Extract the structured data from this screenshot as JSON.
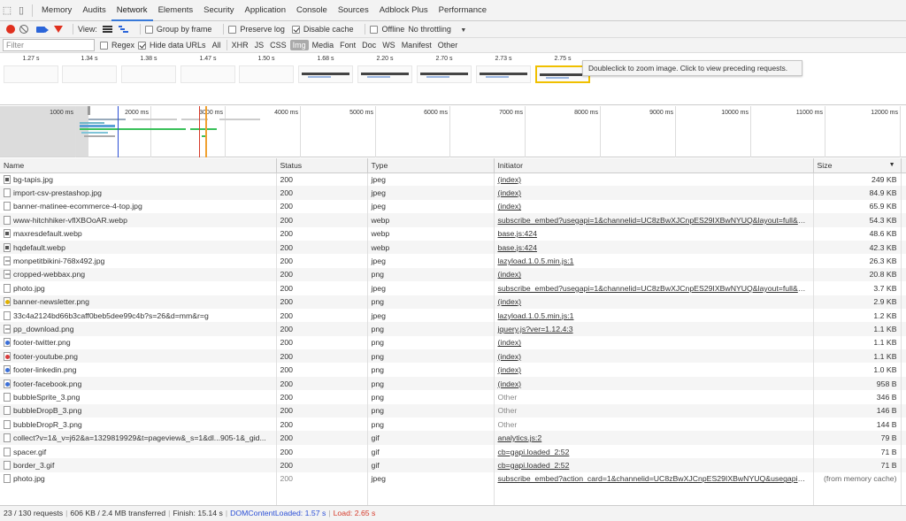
{
  "tabs": [
    "Memory",
    "Audits",
    "Network",
    "Elements",
    "Security",
    "Application",
    "Console",
    "Sources",
    "Adblock Plus",
    "Performance"
  ],
  "active_tab": "Network",
  "toolbar": {
    "view_label": "View:",
    "group_by_frame": "Group by frame",
    "preserve_log": "Preserve log",
    "disable_cache": "Disable cache",
    "offline": "Offline",
    "throttling": "No throttling"
  },
  "filter": {
    "placeholder": "Filter",
    "regex": "Regex",
    "hide_data_urls": "Hide data URLs",
    "types": [
      "All",
      "XHR",
      "JS",
      "CSS",
      "Img",
      "Media",
      "Font",
      "Doc",
      "WS",
      "Manifest",
      "Other"
    ],
    "active_type": "Img"
  },
  "screenshots": [
    "1.27 s",
    "1.34 s",
    "1.38 s",
    "1.47 s",
    "1.50 s",
    "1.68 s",
    "2.20 s",
    "2.70 s",
    "2.73 s",
    "2.75 s"
  ],
  "tooltip": "Doubleclick to zoom image. Click to view preceding requests.",
  "overview": {
    "labels": [
      "1000 ms",
      "2000 ms",
      "3000 ms",
      "4000 ms",
      "5000 ms",
      "6000 ms",
      "7000 ms",
      "8000 ms",
      "9000 ms",
      "10000 ms",
      "11000 ms",
      "12000 ms"
    ],
    "dom_color": "#2b4fd6",
    "load_color": "#d63b2b"
  },
  "columns": {
    "name": "Name",
    "status": "Status",
    "type": "Type",
    "initiator": "Initiator",
    "size": "Size"
  },
  "rows": [
    {
      "name": "bg-tapis.jpg",
      "status": "200",
      "type": "jpeg",
      "initiator": "(index)",
      "size": "249 KB",
      "icon": "img-dark"
    },
    {
      "name": "import-csv-prestashop.jpg",
      "status": "200",
      "type": "jpeg",
      "initiator": "(index)",
      "size": "84.9 KB",
      "icon": "plain"
    },
    {
      "name": "banner-matinee-ecommerce-4-top.jpg",
      "status": "200",
      "type": "jpeg",
      "initiator": "(index)",
      "size": "65.9 KB",
      "icon": "plain"
    },
    {
      "name": "www-hitchhiker-vflXBOoAR.webp",
      "status": "200",
      "type": "webp",
      "initiator": "subscribe_embed?usegapi=1&channelid=UC8zBwXJCnpES29IXBwNYUQ&layout=full&co...",
      "size": "54.3 KB",
      "icon": "plain"
    },
    {
      "name": "maxresdefault.webp",
      "status": "200",
      "type": "webp",
      "initiator": "base.js:424",
      "size": "48.6 KB",
      "icon": "img-dark"
    },
    {
      "name": "hqdefault.webp",
      "status": "200",
      "type": "webp",
      "initiator": "base.js:424",
      "size": "42.3 KB",
      "icon": "img-dark"
    },
    {
      "name": "monpetitbikini-768x492.jpg",
      "status": "200",
      "type": "jpeg",
      "initiator": "lazyload.1.0.5.min.js:1",
      "size": "26.3 KB",
      "icon": "img-light"
    },
    {
      "name": "cropped-webbax.png",
      "status": "200",
      "type": "png",
      "initiator": "(index)",
      "size": "20.8 KB",
      "icon": "img-light"
    },
    {
      "name": "photo.jpg",
      "status": "200",
      "type": "jpeg",
      "initiator": "subscribe_embed?usegapi=1&channelid=UC8zBwXJCnpES29IXBwNYUQ&layout=full&co...",
      "size": "3.7 KB",
      "icon": "plain"
    },
    {
      "name": "banner-newsletter.png",
      "status": "200",
      "type": "png",
      "initiator": "(index)",
      "size": "2.9 KB",
      "icon": "img-yellow"
    },
    {
      "name": "33c4a2124bd66b3caff0beb5dee99c4b?s=26&d=mm&r=g",
      "status": "200",
      "type": "jpeg",
      "initiator": "lazyload.1.0.5.min.js:1",
      "size": "1.2 KB",
      "icon": "plain"
    },
    {
      "name": "pp_download.png",
      "status": "200",
      "type": "png",
      "initiator": "jquery.js?ver=1.12.4:3",
      "size": "1.1 KB",
      "icon": "img-light"
    },
    {
      "name": "footer-twitter.png",
      "status": "200",
      "type": "png",
      "initiator": "(index)",
      "size": "1.1 KB",
      "icon": "img-blue"
    },
    {
      "name": "footer-youtube.png",
      "status": "200",
      "type": "png",
      "initiator": "(index)",
      "size": "1.1 KB",
      "icon": "img-red"
    },
    {
      "name": "footer-linkedin.png",
      "status": "200",
      "type": "png",
      "initiator": "(index)",
      "size": "1.0 KB",
      "icon": "img-blue"
    },
    {
      "name": "footer-facebook.png",
      "status": "200",
      "type": "png",
      "initiator": "(index)",
      "size": "958 B",
      "icon": "img-blue"
    },
    {
      "name": "bubbleSprite_3.png",
      "status": "200",
      "type": "png",
      "initiator": "Other",
      "size": "346 B",
      "icon": "plain"
    },
    {
      "name": "bubbleDropB_3.png",
      "status": "200",
      "type": "png",
      "initiator": "Other",
      "size": "146 B",
      "icon": "plain"
    },
    {
      "name": "bubbleDropR_3.png",
      "status": "200",
      "type": "png",
      "initiator": "Other",
      "size": "144 B",
      "icon": "plain"
    },
    {
      "name": "collect?v=1&_v=j62&a=1329819929&t=pageview&_s=1&dl...905-1&_gid...",
      "status": "200",
      "type": "gif",
      "initiator": "analytics.js:2",
      "size": "79 B",
      "icon": "plain"
    },
    {
      "name": "spacer.gif",
      "status": "200",
      "type": "gif",
      "initiator": "cb=gapi.loaded_2:52",
      "size": "71 B",
      "icon": "plain"
    },
    {
      "name": "border_3.gif",
      "status": "200",
      "type": "gif",
      "initiator": "cb=gapi.loaded_2:52",
      "size": "71 B",
      "icon": "plain"
    },
    {
      "name": "photo.jpg",
      "status": "200",
      "type": "jpeg",
      "initiator": "subscribe_embed?action_card=1&channelid=UC8zBwXJCnpES29IXBwNYUQ&usegapi=1...",
      "size": "(from memory cache)",
      "icon": "plain"
    }
  ],
  "status": {
    "requests": "23 / 130 requests",
    "transferred": "606 KB / 2.4 MB transferred",
    "finish": "Finish: 15.14 s",
    "dom": "DOMContentLoaded: 1.57 s",
    "load": "Load: 2.65 s"
  }
}
